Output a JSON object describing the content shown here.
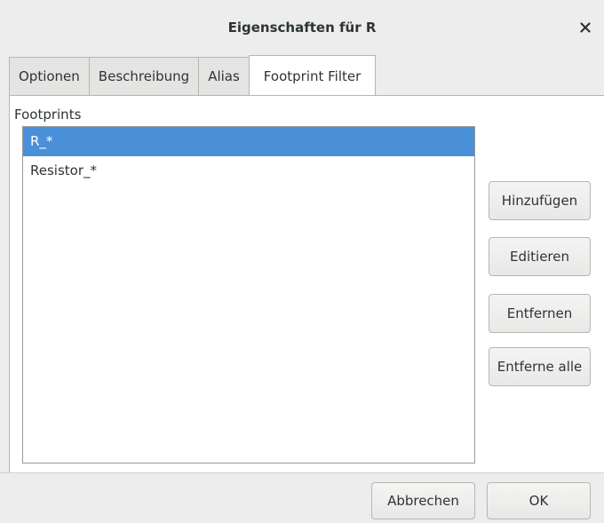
{
  "window": {
    "title": "Eigenschaften für R",
    "close_icon": "close-icon"
  },
  "tabs": [
    {
      "label": "Optionen",
      "active": false
    },
    {
      "label": "Beschreibung",
      "active": false
    },
    {
      "label": "Alias",
      "active": false
    },
    {
      "label": "Footprint Filter",
      "active": true
    }
  ],
  "footprints": {
    "label": "Footprints",
    "items": [
      {
        "text": "R_*",
        "selected": true
      },
      {
        "text": "Resistor_*",
        "selected": false
      }
    ]
  },
  "side_buttons": {
    "add": "Hinzufügen",
    "edit": "Editieren",
    "remove": "Entfernen",
    "remove_all": "Entferne alle"
  },
  "footer": {
    "cancel": "Abbrechen",
    "ok": "OK"
  },
  "colors": {
    "selection": "#4a90d9",
    "background": "#ededed"
  }
}
